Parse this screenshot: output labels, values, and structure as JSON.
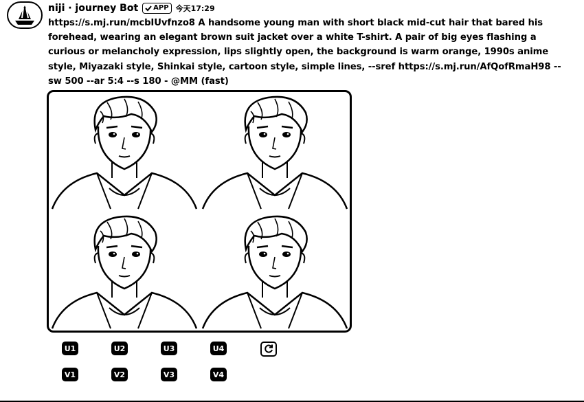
{
  "message": {
    "author": "niji · journey Bot",
    "badge": "APP",
    "time": "今天17:29",
    "prompt_link": "https://s.mj.run/mcbIUvfnzo8",
    "prompt_text": " A handsome young man with short black mid-cut hair that bared his forehead, wearing an elegant brown suit jacket over a white T-shirt. A pair of big eyes flashing a curious or melancholy expression, lips slightly open, the background is warm orange, 1990s anime style, Miyazaki style, Shinkai style, cartoon style, simple lines, --sref ",
    "sref_link": "https://s.mj.run/AfQofRmaH98",
    "prompt_suffix": " --sw 500 --ar 5:4 --s 180 - ",
    "mention": "@MM",
    "mode": " (fast)"
  },
  "actions": {
    "upscale": [
      "U1",
      "U2",
      "U3",
      "U4"
    ],
    "variation": [
      "V1",
      "V2",
      "V3",
      "V4"
    ],
    "reroll_icon": "refresh-icon"
  }
}
